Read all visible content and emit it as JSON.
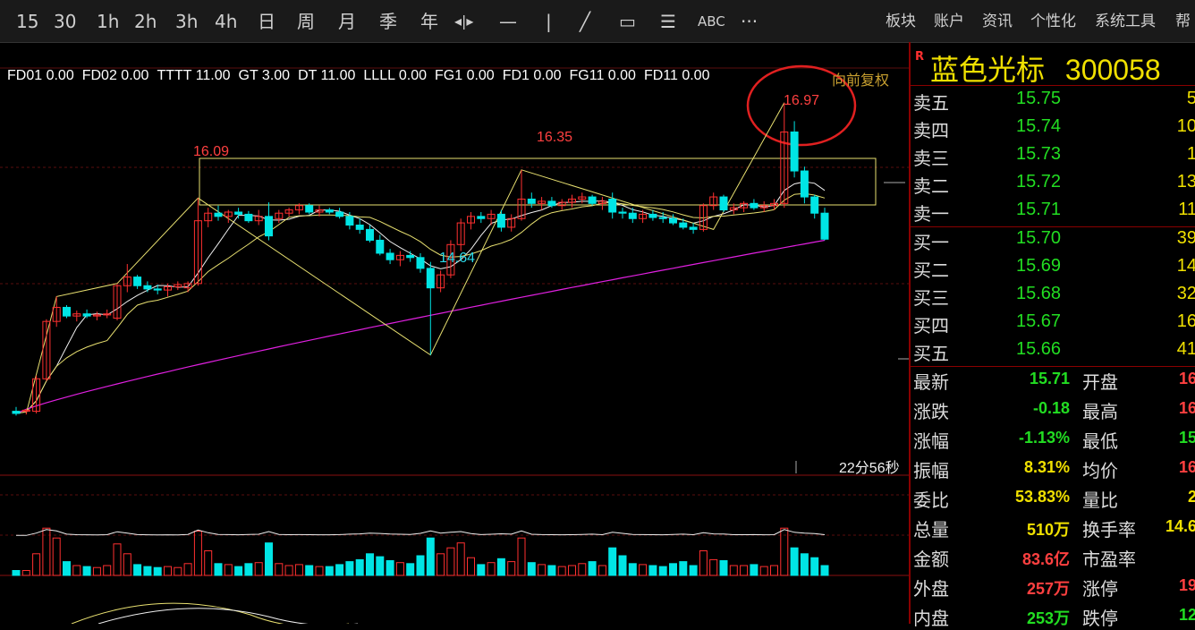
{
  "toolbar": {
    "periods": [
      "15",
      "30",
      "1h",
      "2h",
      "3h",
      "4h",
      "日",
      "周",
      "月",
      "季",
      "年"
    ],
    "tools": {
      "crosshair": "◂|▸",
      "hline": "—",
      "vline": "|",
      "trend": "╱",
      "rect": "▭",
      "fib": "☰",
      "text": "ABC",
      "more": "···"
    },
    "menus": [
      "板块",
      "账户",
      "资讯",
      "个性化",
      "系统工具",
      "帮"
    ]
  },
  "indicators": [
    "FD01 0.00",
    "FD02 0.00",
    "TTTT 11.00",
    "GT 3.00",
    "DT 11.00",
    "LLLL 0.00",
    "FG1 0.00",
    "FD1 0.00",
    "FG11 0.00",
    "FD11 0.00"
  ],
  "adjust_label": "向前复权",
  "annotations": {
    "peak1": "16.09",
    "peak2": "16.35",
    "trough": "14.64",
    "peak3": "16.97"
  },
  "timer": "22分56秒",
  "stock": {
    "badge": "R",
    "name": "蓝色光标",
    "code": "300058"
  },
  "orderbook": {
    "asks": [
      {
        "label": "卖五",
        "price": "15.75",
        "vol": "5"
      },
      {
        "label": "卖四",
        "price": "15.74",
        "vol": "10"
      },
      {
        "label": "卖三",
        "price": "15.73",
        "vol": "1"
      },
      {
        "label": "卖二",
        "price": "15.72",
        "vol": "13"
      },
      {
        "label": "卖一",
        "price": "15.71",
        "vol": "11"
      }
    ],
    "bids": [
      {
        "label": "买一",
        "price": "15.70",
        "vol": "39"
      },
      {
        "label": "买二",
        "price": "15.69",
        "vol": "14"
      },
      {
        "label": "买三",
        "price": "15.68",
        "vol": "32"
      },
      {
        "label": "买四",
        "price": "15.67",
        "vol": "16"
      },
      {
        "label": "买五",
        "price": "15.66",
        "vol": "41"
      }
    ]
  },
  "stats_left": [
    {
      "label": "最新",
      "value": "15.71",
      "color": "#22dd22"
    },
    {
      "label": "涨跌",
      "value": "-0.18",
      "color": "#22dd22"
    },
    {
      "label": "涨幅",
      "value": "-1.13%",
      "color": "#22dd22"
    },
    {
      "label": "振幅",
      "value": "8.31%",
      "color": "#f0e000"
    },
    {
      "label": "委比",
      "value": "53.83%",
      "color": "#f0e000"
    },
    {
      "label": "总量",
      "value": "510万",
      "color": "#f0e000"
    },
    {
      "label": "金额",
      "value": "83.6亿",
      "color": "#ff4040"
    },
    {
      "label": "外盘",
      "value": "257万",
      "color": "#ff4040"
    },
    {
      "label": "内盘",
      "value": "253万",
      "color": "#22dd22"
    }
  ],
  "stats_right": [
    {
      "label": "开盘",
      "value": "16",
      "color": "#ff4040"
    },
    {
      "label": "最高",
      "value": "16",
      "color": "#ff4040"
    },
    {
      "label": "最低",
      "value": "15",
      "color": "#22dd22"
    },
    {
      "label": "均价",
      "value": "16",
      "color": "#ff4040"
    },
    {
      "label": "量比",
      "value": "2",
      "color": "#f0e000"
    },
    {
      "label": "换手率",
      "value": "14.6",
      "color": "#f0e000"
    },
    {
      "label": "市盈率",
      "value": "",
      "color": "#f0e000"
    },
    {
      "label": "涨停",
      "value": "19",
      "color": "#ff4040"
    },
    {
      "label": "跌停",
      "value": "12",
      "color": "#22dd22"
    }
  ],
  "colors": {
    "up": "#ff3030",
    "down": "#00e5e5",
    "ma_purple": "#e020e0",
    "ma_yellow": "#e8e070",
    "box": "#e8e070",
    "grid": "#6a1010"
  },
  "chart_data": {
    "type": "candlestick",
    "title": "",
    "price_range": [
      14.1,
      17.2
    ],
    "candles": [
      {
        "o": 14.12,
        "h": 14.16,
        "l": 14.08,
        "c": 14.1,
        "v": 5
      },
      {
        "o": 14.12,
        "h": 14.14,
        "l": 14.09,
        "c": 14.13,
        "v": 5
      },
      {
        "o": 14.12,
        "h": 14.45,
        "l": 14.1,
        "c": 14.42,
        "v": 22
      },
      {
        "o": 14.42,
        "h": 14.97,
        "l": 14.4,
        "c": 14.95,
        "v": 48
      },
      {
        "o": 14.95,
        "h": 15.18,
        "l": 14.9,
        "c": 15.08,
        "v": 38
      },
      {
        "o": 15.08,
        "h": 15.1,
        "l": 14.98,
        "c": 15.0,
        "v": 14
      },
      {
        "o": 15.0,
        "h": 15.05,
        "l": 14.95,
        "c": 15.02,
        "v": 10
      },
      {
        "o": 15.02,
        "h": 15.06,
        "l": 14.98,
        "c": 15.0,
        "v": 9
      },
      {
        "o": 15.0,
        "h": 15.04,
        "l": 14.96,
        "c": 15.01,
        "v": 8
      },
      {
        "o": 15.01,
        "h": 15.06,
        "l": 14.98,
        "c": 15.02,
        "v": 10
      },
      {
        "o": 14.98,
        "h": 15.3,
        "l": 14.96,
        "c": 15.28,
        "v": 32
      },
      {
        "o": 15.28,
        "h": 15.48,
        "l": 15.22,
        "c": 15.36,
        "v": 22
      },
      {
        "o": 15.36,
        "h": 15.38,
        "l": 15.25,
        "c": 15.28,
        "v": 11
      },
      {
        "o": 15.28,
        "h": 15.32,
        "l": 15.22,
        "c": 15.25,
        "v": 9
      },
      {
        "o": 15.25,
        "h": 15.29,
        "l": 15.2,
        "c": 15.24,
        "v": 8
      },
      {
        "o": 15.24,
        "h": 15.3,
        "l": 15.18,
        "c": 15.27,
        "v": 9
      },
      {
        "o": 15.27,
        "h": 15.32,
        "l": 15.24,
        "c": 15.29,
        "v": 8
      },
      {
        "o": 15.26,
        "h": 15.32,
        "l": 15.22,
        "c": 15.3,
        "v": 12
      },
      {
        "o": 15.3,
        "h": 16.09,
        "l": 15.28,
        "c": 15.88,
        "v": 45
      },
      {
        "o": 15.88,
        "h": 16.0,
        "l": 15.82,
        "c": 15.95,
        "v": 25
      },
      {
        "o": 15.95,
        "h": 16.02,
        "l": 15.88,
        "c": 15.92,
        "v": 12
      },
      {
        "o": 15.92,
        "h": 15.98,
        "l": 15.86,
        "c": 15.96,
        "v": 11
      },
      {
        "o": 15.96,
        "h": 16.0,
        "l": 15.9,
        "c": 15.94,
        "v": 9
      },
      {
        "o": 15.94,
        "h": 15.97,
        "l": 15.86,
        "c": 15.88,
        "v": 12
      },
      {
        "o": 15.88,
        "h": 15.98,
        "l": 15.84,
        "c": 15.92,
        "v": 13
      },
      {
        "o": 15.92,
        "h": 16.05,
        "l": 15.7,
        "c": 15.74,
        "v": 33
      },
      {
        "o": 15.9,
        "h": 15.98,
        "l": 15.86,
        "c": 15.95,
        "v": 12
      },
      {
        "o": 15.95,
        "h": 16.0,
        "l": 15.92,
        "c": 15.98,
        "v": 10
      },
      {
        "o": 15.98,
        "h": 16.04,
        "l": 15.94,
        "c": 16.02,
        "v": 11
      },
      {
        "o": 16.02,
        "h": 16.04,
        "l": 15.94,
        "c": 15.96,
        "v": 10
      },
      {
        "o": 15.96,
        "h": 16.02,
        "l": 15.92,
        "c": 15.98,
        "v": 9
      },
      {
        "o": 15.98,
        "h": 16.0,
        "l": 15.94,
        "c": 15.96,
        "v": 9
      },
      {
        "o": 15.96,
        "h": 16.0,
        "l": 15.9,
        "c": 15.92,
        "v": 11
      },
      {
        "o": 15.92,
        "h": 15.96,
        "l": 15.8,
        "c": 15.84,
        "v": 14
      },
      {
        "o": 15.84,
        "h": 15.9,
        "l": 15.76,
        "c": 15.8,
        "v": 16
      },
      {
        "o": 15.8,
        "h": 15.84,
        "l": 15.68,
        "c": 15.7,
        "v": 22
      },
      {
        "o": 15.7,
        "h": 15.75,
        "l": 15.56,
        "c": 15.58,
        "v": 19
      },
      {
        "o": 15.58,
        "h": 15.62,
        "l": 15.48,
        "c": 15.52,
        "v": 15
      },
      {
        "o": 15.52,
        "h": 15.6,
        "l": 15.46,
        "c": 15.56,
        "v": 13
      },
      {
        "o": 15.56,
        "h": 15.6,
        "l": 15.5,
        "c": 15.54,
        "v": 12
      },
      {
        "o": 15.54,
        "h": 15.58,
        "l": 15.4,
        "c": 15.44,
        "v": 20
      },
      {
        "o": 15.44,
        "h": 15.5,
        "l": 14.64,
        "c": 15.26,
        "v": 38
      },
      {
        "o": 15.26,
        "h": 15.42,
        "l": 15.22,
        "c": 15.38,
        "v": 22
      },
      {
        "o": 15.38,
        "h": 15.7,
        "l": 15.35,
        "c": 15.66,
        "v": 28
      },
      {
        "o": 15.66,
        "h": 15.9,
        "l": 15.6,
        "c": 15.86,
        "v": 33
      },
      {
        "o": 15.86,
        "h": 15.96,
        "l": 15.8,
        "c": 15.92,
        "v": 18
      },
      {
        "o": 15.92,
        "h": 15.96,
        "l": 15.86,
        "c": 15.9,
        "v": 11
      },
      {
        "o": 15.9,
        "h": 15.98,
        "l": 15.84,
        "c": 15.94,
        "v": 13
      },
      {
        "o": 15.94,
        "h": 15.98,
        "l": 15.78,
        "c": 15.82,
        "v": 17
      },
      {
        "o": 15.82,
        "h": 15.94,
        "l": 15.78,
        "c": 15.9,
        "v": 14
      },
      {
        "o": 15.9,
        "h": 16.35,
        "l": 15.88,
        "c": 16.08,
        "v": 38
      },
      {
        "o": 16.08,
        "h": 16.14,
        "l": 16.0,
        "c": 16.04,
        "v": 13
      },
      {
        "o": 16.04,
        "h": 16.1,
        "l": 15.98,
        "c": 16.06,
        "v": 11
      },
      {
        "o": 16.06,
        "h": 16.1,
        "l": 16.0,
        "c": 16.02,
        "v": 10
      },
      {
        "o": 16.02,
        "h": 16.08,
        "l": 15.98,
        "c": 16.05,
        "v": 9
      },
      {
        "o": 16.05,
        "h": 16.12,
        "l": 16.0,
        "c": 16.08,
        "v": 10
      },
      {
        "o": 16.08,
        "h": 16.14,
        "l": 16.04,
        "c": 16.1,
        "v": 12
      },
      {
        "o": 16.1,
        "h": 16.12,
        "l": 16.02,
        "c": 16.04,
        "v": 14
      },
      {
        "o": 16.04,
        "h": 16.1,
        "l": 15.98,
        "c": 16.06,
        "v": 10
      },
      {
        "o": 16.08,
        "h": 16.14,
        "l": 15.9,
        "c": 15.96,
        "v": 28
      },
      {
        "o": 15.96,
        "h": 16.0,
        "l": 15.9,
        "c": 15.95,
        "v": 20
      },
      {
        "o": 15.95,
        "h": 16.0,
        "l": 15.86,
        "c": 15.9,
        "v": 12
      },
      {
        "o": 15.9,
        "h": 15.98,
        "l": 15.86,
        "c": 15.94,
        "v": 11
      },
      {
        "o": 15.94,
        "h": 15.98,
        "l": 15.88,
        "c": 15.91,
        "v": 10
      },
      {
        "o": 15.91,
        "h": 15.96,
        "l": 15.86,
        "c": 15.9,
        "v": 9
      },
      {
        "o": 15.9,
        "h": 15.94,
        "l": 15.84,
        "c": 15.86,
        "v": 12
      },
      {
        "o": 15.86,
        "h": 15.9,
        "l": 15.8,
        "c": 15.82,
        "v": 14
      },
      {
        "o": 15.82,
        "h": 15.86,
        "l": 15.76,
        "c": 15.8,
        "v": 10
      },
      {
        "o": 15.8,
        "h": 16.04,
        "l": 15.78,
        "c": 16.02,
        "v": 25
      },
      {
        "o": 16.02,
        "h": 16.14,
        "l": 15.98,
        "c": 16.1,
        "v": 16
      },
      {
        "o": 16.1,
        "h": 16.12,
        "l": 15.96,
        "c": 15.98,
        "v": 15
      },
      {
        "o": 15.98,
        "h": 16.04,
        "l": 15.94,
        "c": 16.0,
        "v": 10
      },
      {
        "o": 16.0,
        "h": 16.06,
        "l": 15.96,
        "c": 16.04,
        "v": 10
      },
      {
        "o": 16.04,
        "h": 16.08,
        "l": 15.98,
        "c": 16.0,
        "v": 11
      },
      {
        "o": 16.0,
        "h": 16.06,
        "l": 15.96,
        "c": 16.02,
        "v": 9
      },
      {
        "o": 16.02,
        "h": 16.08,
        "l": 15.98,
        "c": 16.04,
        "v": 10
      },
      {
        "o": 16.04,
        "h": 16.97,
        "l": 16.0,
        "c": 16.7,
        "v": 48
      },
      {
        "o": 16.7,
        "h": 16.8,
        "l": 16.28,
        "c": 16.34,
        "v": 28
      },
      {
        "o": 16.34,
        "h": 16.38,
        "l": 16.04,
        "c": 16.1,
        "v": 22
      },
      {
        "o": 16.1,
        "h": 16.12,
        "l": 15.9,
        "c": 15.95,
        "v": 18
      },
      {
        "o": 15.95,
        "h": 16.0,
        "l": 15.7,
        "c": 15.71,
        "v": 10
      }
    ]
  }
}
